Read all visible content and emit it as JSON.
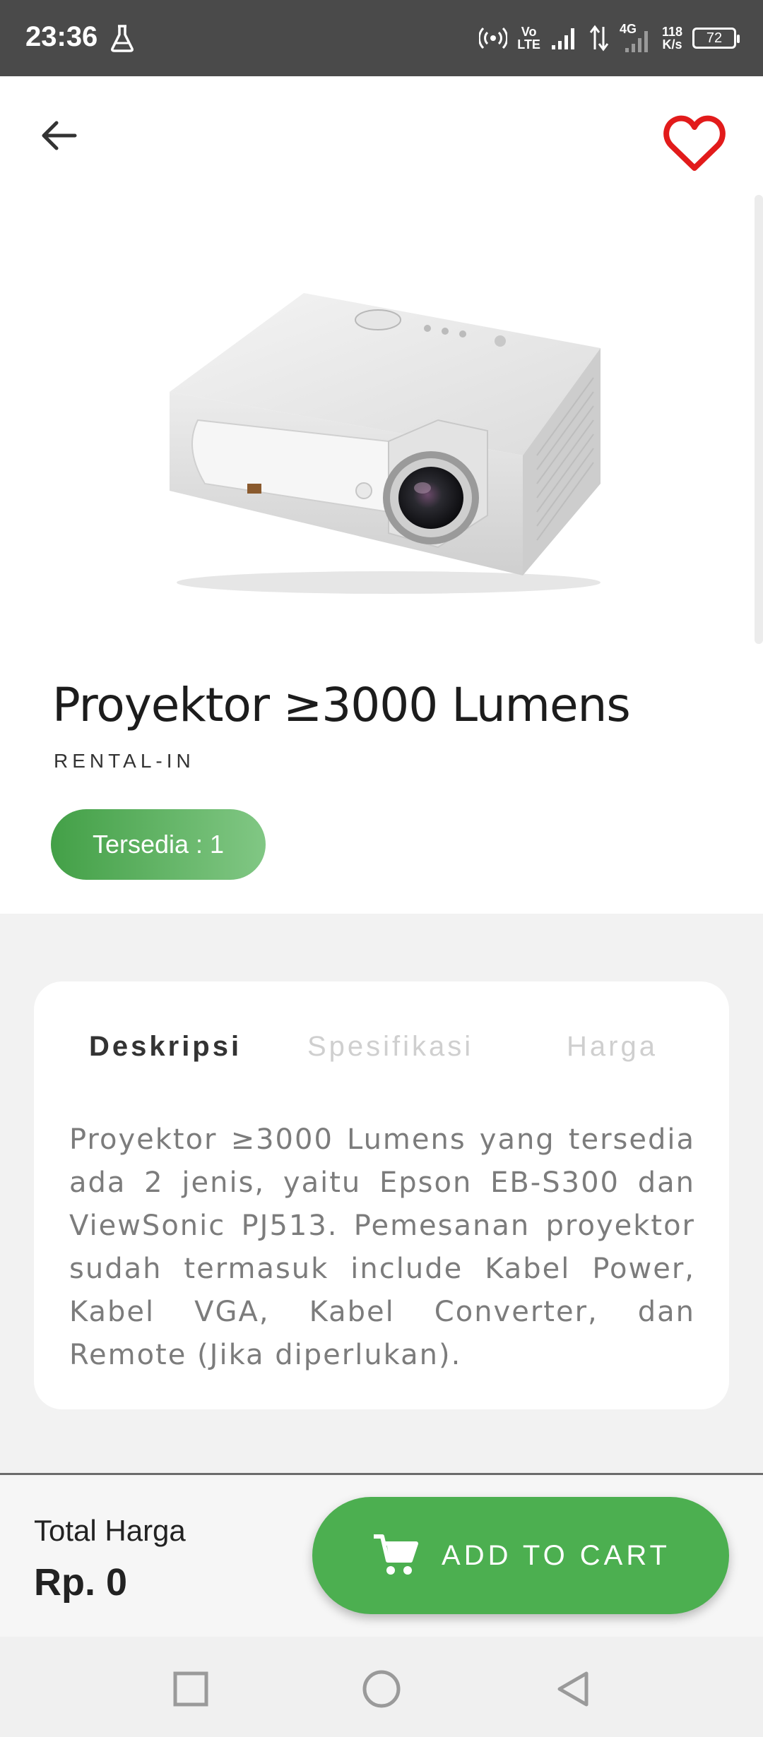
{
  "status_bar": {
    "time": "23:36",
    "net_top": "Vo",
    "net_bottom": "LTE",
    "gen": "4G",
    "speed_top": "118",
    "speed_bottom": "K/s",
    "battery": "72"
  },
  "product": {
    "title": "Proyektor ≥3000 Lumens",
    "vendor": "RENTAL-IN",
    "stock": "Tersedia : 1"
  },
  "tabs": [
    {
      "label": "Deskripsi",
      "active": true
    },
    {
      "label": "Spesifikasi",
      "active": false
    },
    {
      "label": "Harga",
      "active": false
    }
  ],
  "description": "Proyektor ≥3000 Lumens yang tersedia ada 2 jenis, yaitu Epson EB-S300 dan ViewSonic PJ513. Pemesanan proyektor sudah termasuk include Kabel Power, Kabel VGA, Kabel Converter, dan Remote (Jika diperlukan).",
  "footer": {
    "total_label": "Total Harga",
    "total_value": "Rp. 0",
    "cart_button": "ADD TO CART"
  },
  "colors": {
    "accent_green": "#4caf50",
    "favorite_red": "#e21b1b",
    "status_bar": "#4a4a4a"
  },
  "icons": [
    "flask-icon",
    "hotspot-icon",
    "signal-icon",
    "data-arrows-icon",
    "battery-icon",
    "back-arrow-icon",
    "heart-icon",
    "cart-icon",
    "recents-icon",
    "home-icon",
    "back-nav-icon"
  ]
}
